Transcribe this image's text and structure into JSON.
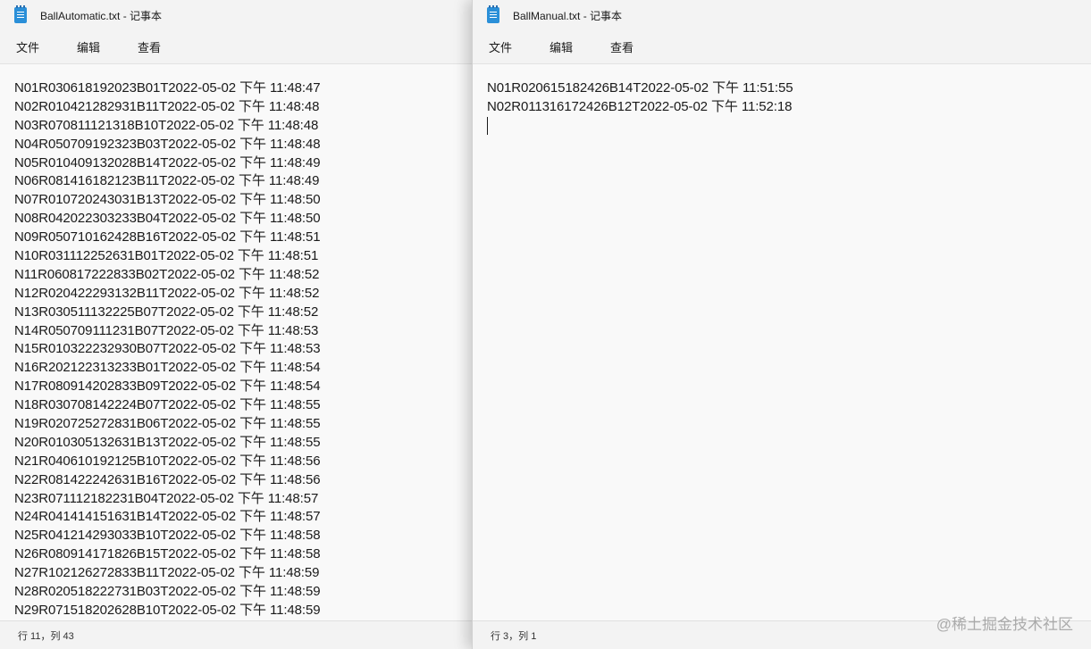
{
  "left_window": {
    "title": "BallAutomatic.txt - 记事本",
    "menu": [
      "文件",
      "编辑",
      "查看"
    ],
    "lines": [
      "N01R030618192023B01T2022-05-02 下午 11:48:47",
      "N02R010421282931B11T2022-05-02 下午 11:48:48",
      "N03R070811121318B10T2022-05-02 下午 11:48:48",
      "N04R050709192323B03T2022-05-02 下午 11:48:48",
      "N05R010409132028B14T2022-05-02 下午 11:48:49",
      "N06R081416182123B11T2022-05-02 下午 11:48:49",
      "N07R010720243031B13T2022-05-02 下午 11:48:50",
      "N08R042022303233B04T2022-05-02 下午 11:48:50",
      "N09R050710162428B16T2022-05-02 下午 11:48:51",
      "N10R031112252631B01T2022-05-02 下午 11:48:51",
      "N11R060817222833B02T2022-05-02 下午 11:48:52",
      "N12R020422293132B11T2022-05-02 下午 11:48:52",
      "N13R030511132225B07T2022-05-02 下午 11:48:52",
      "N14R050709111231B07T2022-05-02 下午 11:48:53",
      "N15R010322232930B07T2022-05-02 下午 11:48:53",
      "N16R202122313233B01T2022-05-02 下午 11:48:54",
      "N17R080914202833B09T2022-05-02 下午 11:48:54",
      "N18R030708142224B07T2022-05-02 下午 11:48:55",
      "N19R020725272831B06T2022-05-02 下午 11:48:55",
      "N20R010305132631B13T2022-05-02 下午 11:48:55",
      "N21R040610192125B10T2022-05-02 下午 11:48:56",
      "N22R081422242631B16T2022-05-02 下午 11:48:56",
      "N23R071112182231B04T2022-05-02 下午 11:48:57",
      "N24R041414151631B14T2022-05-02 下午 11:48:57",
      "N25R041214293033B10T2022-05-02 下午 11:48:58",
      "N26R080914171826B15T2022-05-02 下午 11:48:58",
      "N27R102126272833B11T2022-05-02 下午 11:48:59",
      "N28R020518222731B03T2022-05-02 下午 11:48:59",
      "N29R071518202628B10T2022-05-02 下午 11:48:59"
    ],
    "status": "行 11，列 43"
  },
  "right_window": {
    "title": "BallManual.txt - 记事本",
    "menu": [
      "文件",
      "编辑",
      "查看"
    ],
    "lines": [
      "N01R020615182426B14T2022-05-02 下午 11:51:55",
      "N02R011316172426B12T2022-05-02 下午 11:52:18"
    ],
    "status": "行 3，列 1"
  },
  "watermark": "@稀土掘金技术社区",
  "icons": {
    "app": "notepad-icon"
  }
}
